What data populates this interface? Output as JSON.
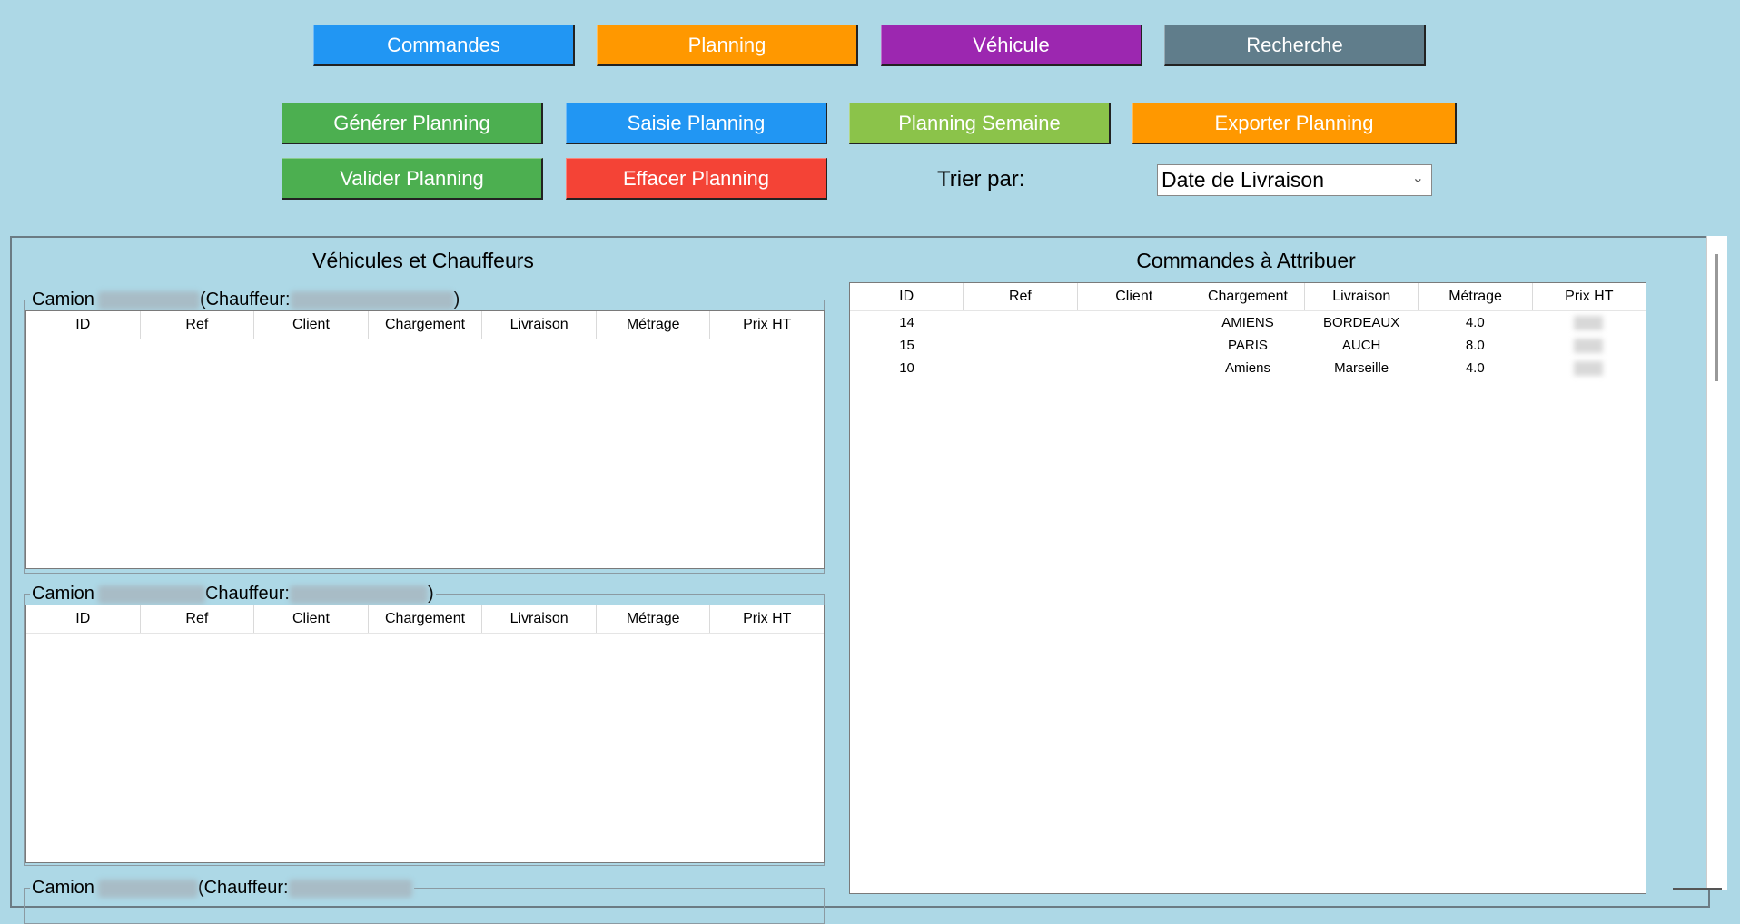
{
  "nav": {
    "buttons": [
      {
        "label": "Commandes",
        "color": "#2196f3"
      },
      {
        "label": "Planning",
        "color": "#ff9800"
      },
      {
        "label": "Véhicule",
        "color": "#9c27b0"
      },
      {
        "label": "Recherche",
        "color": "#607d8b"
      }
    ]
  },
  "actions": {
    "generate": {
      "label": "Générer Planning",
      "color": "#4caf50"
    },
    "saisie": {
      "label": "Saisie Planning",
      "color": "#2196f3"
    },
    "semaine": {
      "label": "Planning Semaine",
      "color": "#8bc34a"
    },
    "exporter": {
      "label": "Exporter Planning",
      "color": "#ff9800"
    },
    "valider": {
      "label": "Valider Planning",
      "color": "#4caf50"
    },
    "effacer": {
      "label": "Effacer Planning",
      "color": "#f44336"
    }
  },
  "sort": {
    "label": "Trier par:",
    "selected": "Date de Livraison"
  },
  "left_panel": {
    "title": "Véhicules et Chauffeurs",
    "columns": [
      "ID",
      "Ref",
      "Client",
      "Chargement",
      "Livraison",
      "Métrage",
      "Prix HT"
    ],
    "trucks": [
      {
        "prefix": "Camion",
        "driver_label": "(Chauffeur:",
        "suffix": ")"
      },
      {
        "prefix": "Camion",
        "driver_label": "Chauffeur:",
        "suffix": ")"
      },
      {
        "prefix": "Camion",
        "driver_label": "(Chauffeur:",
        "suffix": ""
      }
    ]
  },
  "right_panel": {
    "title": "Commandes à Attribuer",
    "columns": [
      "ID",
      "Ref",
      "Client",
      "Chargement",
      "Livraison",
      "Métrage",
      "Prix HT"
    ],
    "rows": [
      {
        "id": "14",
        "ref": "",
        "client": "",
        "chargement": "AMIENS",
        "livraison": "BORDEAUX",
        "metrage": "4.0"
      },
      {
        "id": "15",
        "ref": "",
        "client": "",
        "chargement": "PARIS",
        "livraison": "AUCH",
        "metrage": "8.0"
      },
      {
        "id": "10",
        "ref": "",
        "client": "",
        "chargement": "Amiens",
        "livraison": "Marseille",
        "metrage": "4.0"
      }
    ]
  }
}
